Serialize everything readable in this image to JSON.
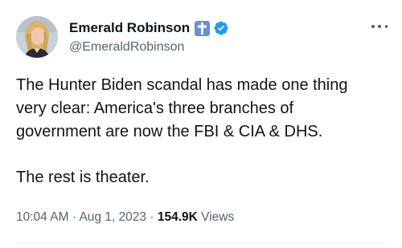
{
  "author": {
    "display_name": "Emerald Robinson",
    "handle": "@EmeraldRobinson",
    "badges": [
      "cross-icon",
      "verified-check-icon"
    ]
  },
  "tweet": {
    "lines": [
      "The Hunter Biden scandal has made one thing",
      "very clear: America's three branches of",
      "government are now the FBI & CIA & DHS.",
      "The rest is theater."
    ]
  },
  "meta": {
    "time": "10:04 AM",
    "separator": "·",
    "date": "Aug 1, 2023",
    "views_count": "154.9K",
    "views_label": "Views"
  },
  "colors": {
    "text_primary": "#0f1419",
    "text_secondary": "#536471",
    "verified_blue": "#1d9bf0",
    "cross_badge": "#6a8ed6"
  }
}
